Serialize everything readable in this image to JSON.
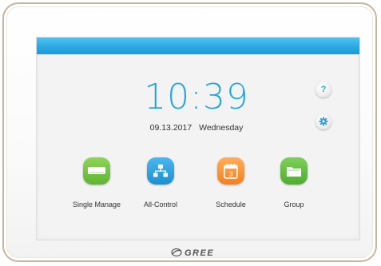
{
  "clock": {
    "time": "10:39",
    "date": "09.13.2017",
    "weekday": "Wednesday"
  },
  "buttons": {
    "help_icon": "question-mark-icon",
    "help_glyph": "?",
    "settings_icon": "gear-icon"
  },
  "apps": [
    {
      "label": "Single Manage",
      "icon": "air-conditioner-icon",
      "color": "#6cc23d"
    },
    {
      "label": "All-Control",
      "icon": "network-hierarchy-icon",
      "color": "#2aa3e4"
    },
    {
      "label": "Schedule",
      "icon": "calendar-icon",
      "color": "#f8913a",
      "icon_text": "3"
    },
    {
      "label": "Group",
      "icon": "folder-icon",
      "color": "#62bf3c"
    }
  ],
  "brand": {
    "logo_text": "GREE",
    "accent_color": "#23a6e2",
    "bar_color": "#2aa7e3"
  }
}
